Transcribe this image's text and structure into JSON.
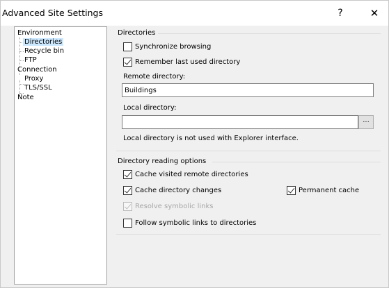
{
  "window": {
    "title": "Advanced Site Settings",
    "help_glyph": "?",
    "close_glyph": "✕"
  },
  "tree": {
    "items": [
      {
        "label": "Environment"
      },
      {
        "label": "Directories",
        "selected": true
      },
      {
        "label": "Recycle bin"
      },
      {
        "label": "FTP"
      },
      {
        "label": "Connection"
      },
      {
        "label": "Proxy"
      },
      {
        "label": "TLS/SSL"
      },
      {
        "label": "Note"
      }
    ]
  },
  "directories": {
    "title": "Directories",
    "synchronize_browsing": {
      "label": "Synchronize browsing",
      "checked": false
    },
    "remember_last_dir": {
      "label": "Remember last used directory",
      "checked": true
    },
    "remote_dir_label": "Remote directory:",
    "remote_dir_value": "Buildings",
    "local_dir_label": "Local directory:",
    "local_dir_value": "",
    "browse_label": "...",
    "local_note": "Local directory is not used with Explorer interface."
  },
  "reading_options": {
    "title": "Directory reading options",
    "cache_visited": {
      "label": "Cache visited remote directories",
      "checked": true
    },
    "cache_changes": {
      "label": "Cache directory changes",
      "checked": true
    },
    "permanent_cache": {
      "label": "Permanent cache",
      "checked": true
    },
    "resolve_symlinks": {
      "label": "Resolve symbolic links",
      "checked": true,
      "disabled": true
    },
    "follow_symlinks": {
      "label": "Follow symbolic links to directories",
      "checked": false
    }
  }
}
